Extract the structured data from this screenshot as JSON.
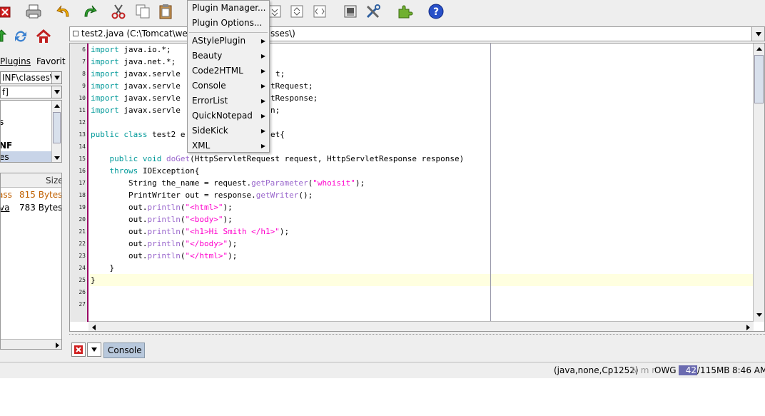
{
  "toolbar": {
    "icons": [
      "close-buffer-icon",
      "print-icon",
      "undo-icon",
      "redo-icon",
      "cut-icon",
      "copy-icon",
      "paste-icon",
      "fold-icon",
      "unfold-icon",
      "expand-icon",
      "global-options-icon",
      "tools-icon",
      "plugin-manager-icon",
      "help-icon"
    ]
  },
  "left_panel": {
    "tabs": {
      "plugins": "Plugins",
      "favorites": "Favorit"
    },
    "path_combo": "INF\\classes\\",
    "filter_combo": "f]",
    "tree": [
      {
        "label": "s"
      },
      {
        "label": "NF"
      },
      {
        "label": "es"
      }
    ],
    "files_header": {
      "size": "Size"
    },
    "files": [
      {
        "name": "ass",
        "size": "815 Bytes"
      },
      {
        "name": "va",
        "size": "783 Bytes"
      }
    ]
  },
  "buffer": {
    "title": "test2.java (C:\\Tomcat\\weba",
    "title_tail": "sses\\)"
  },
  "editor": {
    "line_numbers": [
      "6",
      "7",
      "8",
      "9",
      "10",
      "11",
      "12",
      "13",
      "14",
      "15",
      "16",
      "17",
      "18",
      "19",
      "20",
      "21",
      "22",
      "23",
      "24",
      "25",
      "26",
      "27"
    ],
    "lines": {
      "l6": "java.io.*;",
      "l7": "java.net.*;",
      "l8a": "javax.servle",
      "l8b": "t;",
      "l9a": "javax.servle",
      "l9b": "tRequest;",
      "l10a": "javax.servle",
      "l10b": "tResponse;",
      "l11a": "javax.servle",
      "l11b": "n;",
      "l13a": "test2 e",
      "l13b": "et{",
      "l15a": "(HttpServletRequest request, HttpServletResponse response)",
      "l16": " IOException{",
      "l17a": "        String the_name = request.",
      "l17b": "getParameter",
      "l17c": "(",
      "l17d": "\"whoisit\"",
      "l17e": ");",
      "l18a": "        PrintWriter out = response.",
      "l18b": "getWriter",
      "l18c": "();",
      "l19": "\"<html>\"",
      "l20": "\"<body>\"",
      "l21": "\"<h1>Hi Smith </h1>\"",
      "l22": "\"</body>\"",
      "l23": "\"</html>\"",
      "l24": "    }",
      "l25": "}"
    },
    "keywords": {
      "import": "import",
      "public": "public",
      "class": "class",
      "void": "void",
      "doGet": "doGet",
      "throws": "throws",
      "out": "        out.",
      "println": "println",
      "paren_open": "(",
      "paren_close": ");"
    }
  },
  "menu": {
    "items": [
      {
        "label": "Plugin Manager...",
        "submenu": false
      },
      {
        "label": "Plugin Options...",
        "submenu": false
      },
      {
        "label": "AStylePlugin",
        "submenu": true
      },
      {
        "label": "Beauty",
        "submenu": true
      },
      {
        "label": "Code2HTML",
        "submenu": true
      },
      {
        "label": "Console",
        "submenu": true
      },
      {
        "label": "ErrorList",
        "submenu": true
      },
      {
        "label": "QuickNotepad",
        "submenu": true
      },
      {
        "label": "SideKick",
        "submenu": true
      },
      {
        "label": "XML",
        "submenu": true
      }
    ]
  },
  "console": {
    "tab_label": "Console"
  },
  "status": {
    "mode": "(java,none,Cp1252)",
    "flags": "N m r",
    "flags2": "OWG",
    "memory_used": "42",
    "memory_total": "/115MB",
    "time": "8:46 AM"
  },
  "colors": {
    "keyword": "#009999",
    "method": "#9966cc",
    "string": "#ff00cc",
    "gutter_border": "#990066",
    "current_line": "#ffffe0",
    "memory_bar": "#6b6bb0"
  }
}
